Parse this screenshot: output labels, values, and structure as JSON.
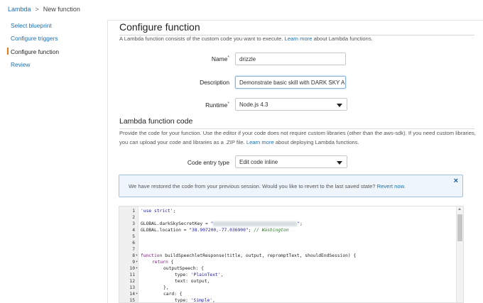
{
  "breadcrumb": {
    "root": "Lambda",
    "separator": ">",
    "current": "New function"
  },
  "sidebar": {
    "items": [
      {
        "label": "Select blueprint",
        "active": false
      },
      {
        "label": "Configure triggers",
        "active": false
      },
      {
        "label": "Configure function",
        "active": true
      },
      {
        "label": "Review",
        "active": false
      }
    ]
  },
  "configure": {
    "title": "Configure function",
    "intro_pre": "A Lambda function consists of the custom code you want to execute.",
    "intro_link": "Learn more",
    "intro_post": "about Lambda functions."
  },
  "form": {
    "name_label": "Name",
    "name_value": "drizzle",
    "description_label": "Description",
    "description_value": "Demonstrate basic skill with DARK SKY API",
    "runtime_label": "Runtime",
    "runtime_value": "Node.js 4.3",
    "required_mark": "*"
  },
  "code_section": {
    "title": "Lambda function code",
    "desc_pre": "Provide the code for your function. Use the editor if your code does not require custom libraries (other than the aws-sdk). If you need custom libraries, you can upload your code and libraries as a .ZIP file.",
    "desc_link": "Learn more",
    "desc_post": "about deploying Lambda functions.",
    "entry_label": "Code entry type",
    "entry_value": "Edit code inline"
  },
  "alert": {
    "text": "We have restored the code from your previous session. Would you like to revert to the last saved state?",
    "link": "Revert now.",
    "close": "×"
  },
  "editor": {
    "fold_marker": "▾",
    "lines": [
      {
        "n": "1"
      },
      {
        "n": "2"
      },
      {
        "n": "3"
      },
      {
        "n": "4"
      },
      {
        "n": "5"
      },
      {
        "n": "6"
      },
      {
        "n": "7"
      },
      {
        "n": "8",
        "fold": true
      },
      {
        "n": "9",
        "fold": true
      },
      {
        "n": "10",
        "fold": true
      },
      {
        "n": "11"
      },
      {
        "n": "12"
      },
      {
        "n": "13"
      },
      {
        "n": "14",
        "fold": true
      },
      {
        "n": "15"
      }
    ],
    "code": {
      "l1": "'use strict';",
      "l3_pre": "GLOBAL.darkSkySecretKey = ",
      "l3_q1": "\"",
      "l3_q2": "\"",
      "l3_end": ";",
      "l4_pre": "GLOBAL.location = ",
      "l4_str": "\"38.907200,-77.036900\"",
      "l4_mid": "; ",
      "l4_com": "// Washington",
      "l8_kw": "function",
      "l8_rest": " buildSpeechletResponse(title, output, repromptText, shouldEndSession) {",
      "l9_kw": "return",
      "l9_rest": " {",
      "l10": "outputSpeech: {",
      "l11_pre": "type: ",
      "l11_str": "'PlainText'",
      "l11_post": ",",
      "l12": "text: output,",
      "l13": "},",
      "l14": "card: {",
      "l15_pre": "type: ",
      "l15_str": "'Simple'",
      "l15_post": ","
    }
  }
}
